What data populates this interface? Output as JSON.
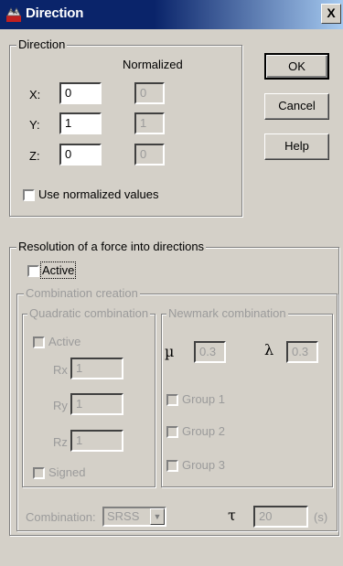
{
  "window": {
    "title": "Direction",
    "close_label": "X"
  },
  "direction": {
    "group_label": "Direction",
    "normalized_header": "Normalized",
    "rows": [
      {
        "axis": "X:",
        "value": "0",
        "normalized": "0"
      },
      {
        "axis": "Y:",
        "value": "1",
        "normalized": "1"
      },
      {
        "axis": "Z:",
        "value": "0",
        "normalized": "0"
      }
    ],
    "use_normalized_label": "Use normalized values"
  },
  "buttons": {
    "ok": "OK",
    "cancel": "Cancel",
    "help": "Help"
  },
  "resolution": {
    "group_label": "Resolution of a force into directions",
    "active_label": "Active",
    "combination_creation": {
      "group_label": "Combination creation",
      "quadratic": {
        "group_label": "Quadratic combination",
        "active_label": "Active",
        "rows": [
          {
            "label": "Rx",
            "value": "1"
          },
          {
            "label": "Ry",
            "value": "1"
          },
          {
            "label": "Rz",
            "value": "1"
          }
        ],
        "signed_label": "Signed"
      },
      "newmark": {
        "group_label": "Newmark combination",
        "mu_symbol": "µ",
        "mu_value": "0.3",
        "lambda_symbol": "λ",
        "lambda_value": "0.3",
        "groups": [
          "Group 1",
          "Group 2",
          "Group 3"
        ]
      },
      "combination_label": "Combination:",
      "combination_value": "SRSS",
      "tau_symbol": "τ",
      "tau_value": "20",
      "tau_unit": "(s)"
    }
  }
}
